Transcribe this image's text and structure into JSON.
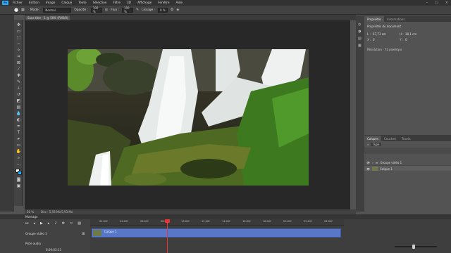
{
  "menubar": {
    "logo": "Ps",
    "items": [
      "Fichier",
      "Edition",
      "Image",
      "Calque",
      "Texte",
      "Sélection",
      "Filtre",
      "3D",
      "Affichage",
      "Fenêtre",
      "Aide"
    ]
  },
  "options": {
    "mode_label": "Mode :",
    "mode_value": "Normal",
    "opacity_label": "Opacité :",
    "opacity_value": "100 %",
    "flux_label": "Flux :",
    "flux_value": "100 %",
    "lissage_label": "Lissage :",
    "lissage_value": "0 %"
  },
  "document": {
    "tab_title": "Sans titre - 1 @ 50% (RVB/8)",
    "zoom": "50 %",
    "doc_info": "Doc : 5,93 Mo/5,93 Mo"
  },
  "properties": {
    "tabs": [
      "Propriétés",
      "Informations"
    ],
    "heading": "Propriétés du document",
    "w_label": "L :",
    "w_value": "67,73 cm",
    "h_label": "H :",
    "h_value": "38,1 cm",
    "x_label": "X :",
    "x_value": "0",
    "y_label": "Y :",
    "y_value": "0",
    "resolution": "Résolution : 72 pixels/po"
  },
  "layers": {
    "tabs": [
      "Calques",
      "Couches",
      "Tracés"
    ],
    "filter_label": "Type",
    "rows": [
      {
        "name": "Groupe vidéo 1"
      },
      {
        "name": "Calque 1"
      }
    ]
  },
  "timeline": {
    "title": "Montage",
    "track_label": "Groupe vidéo 1",
    "audio_label": "Piste audio",
    "timecode": "0:00:03:13",
    "clip_label": "Calque 1",
    "ticks": [
      "02:00f",
      "04:00f",
      "06:00f",
      "08:00f",
      "10:00f",
      "12:00f",
      "14:00f",
      "16:00f",
      "18:00f",
      "20:00f",
      "22:00f",
      "24:00f"
    ],
    "position": 0.3
  },
  "colors": {
    "accent": "#31a8ff",
    "clip": "#5877c8",
    "playhead": "#ee3333"
  }
}
